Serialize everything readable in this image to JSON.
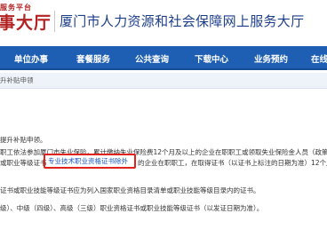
{
  "header": {
    "logo_top": "服务平台",
    "logo_main": "事大厅",
    "site_title": "厦门市人力资源和社会保障网上服务大厅"
  },
  "nav": {
    "items": [
      "单位办事",
      "套餐服务",
      "公共查询",
      "下载中心",
      "业务预约",
      "在线"
    ]
  },
  "breadcrumb": "升补贴申领",
  "content": {
    "line1": "提升补贴申领。",
    "line2": "职工依法参加厦门市失业保险，累计缴纳失业保险费12个月及以上的企业在职职工或领取失业保险金人员（政策1",
    "line3_prefix": "或职业等级证书",
    "link": "专业技术职业资格证书除外",
    "line3_suffix": "的企业在职职工，在取得证书（以证书上标注的日期为准）12个月",
    "line4": "证书或职业技能等级证书应为列入国家职业资格目录清单或职业技能等级目录内的证书。",
    "line5": "级）、中级（四级）、高级（三级）职业资格证书或职业技能等级证书（以发证日期为准）。"
  },
  "colors": {
    "brand_red": "#b22222",
    "nav_blue": "#1e5fb3",
    "highlight_red": "#e0241d",
    "link_blue": "#1a56c4"
  }
}
